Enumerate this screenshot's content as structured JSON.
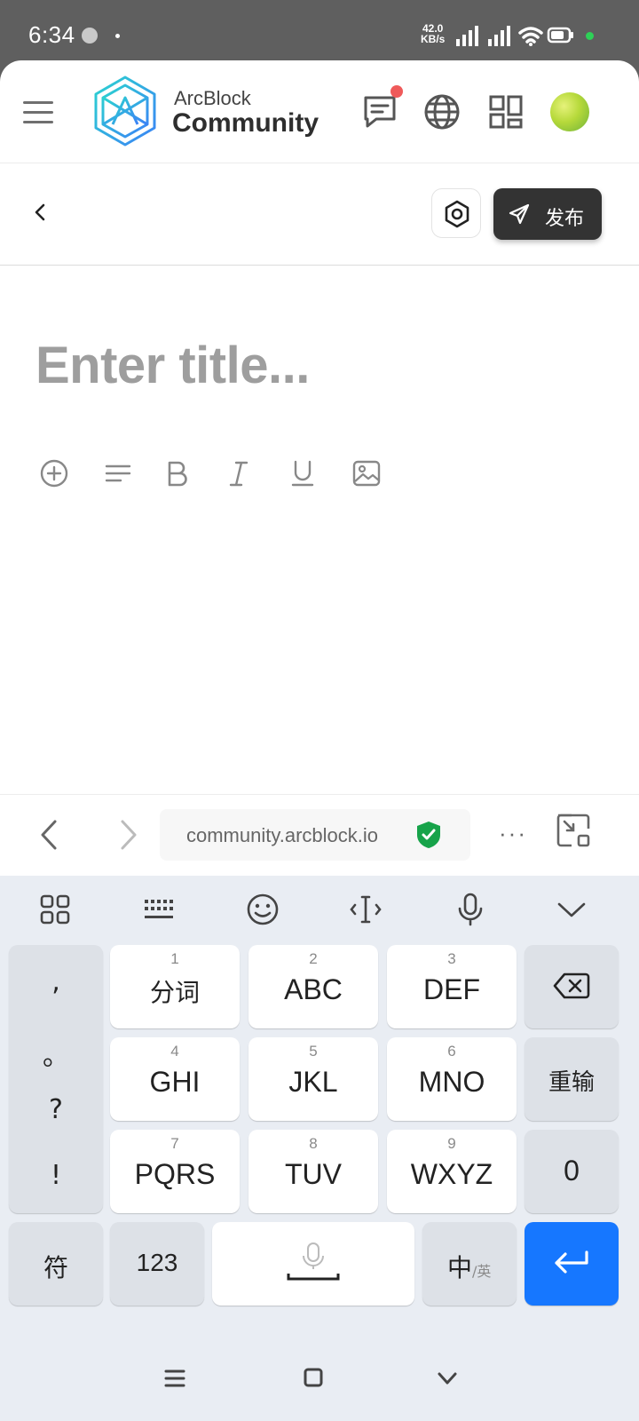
{
  "status_bar": {
    "time": "6:34",
    "net_speed_value": "42.0",
    "net_speed_unit": "KB/s",
    "icons": [
      "wrench-icon",
      "signal-icon",
      "signal-icon",
      "wifi-icon",
      "battery-icon"
    ]
  },
  "header": {
    "brand_top": "ArcBlock",
    "brand_bottom": "Community",
    "icons": [
      "menu-icon",
      "messages-icon",
      "globe-icon",
      "apps-grid-icon",
      "avatar"
    ]
  },
  "editor_toolbar": {
    "publish_label": "发布",
    "icons": [
      "back-chevron-icon",
      "settings-hexagon-icon",
      "send-icon"
    ]
  },
  "editor": {
    "title_placeholder": "Enter title...",
    "format_icons": [
      "insert-plus-icon",
      "paragraph-icon",
      "bold-icon",
      "italic-icon",
      "underline-icon",
      "image-icon"
    ]
  },
  "browser_bar": {
    "url": "community.arcblock.io",
    "more": "···",
    "icons": [
      "back-icon",
      "forward-icon",
      "secure-shield-icon",
      "exit-fullscreen-icon"
    ]
  },
  "keyboard": {
    "toolbar_icons": [
      "apps-icon",
      "keyboard-icon",
      "emoji-icon",
      "cursor-icon",
      "mic-icon",
      "collapse-icon"
    ],
    "punctuation": [
      ",",
      "。",
      "?",
      "!"
    ],
    "keys": [
      {
        "num": "1",
        "label": "分词"
      },
      {
        "num": "2",
        "label": "ABC"
      },
      {
        "num": "3",
        "label": "DEF"
      },
      {
        "num": "4",
        "label": "GHI"
      },
      {
        "num": "5",
        "label": "JKL"
      },
      {
        "num": "6",
        "label": "MNO"
      },
      {
        "num": "7",
        "label": "PQRS"
      },
      {
        "num": "8",
        "label": "TUV"
      },
      {
        "num": "9",
        "label": "WXYZ"
      }
    ],
    "reenter_label": "重输",
    "zero_label": "0",
    "symbols_label": "符",
    "numbers_label": "123",
    "lang_main": "中",
    "lang_alt": "/英"
  }
}
